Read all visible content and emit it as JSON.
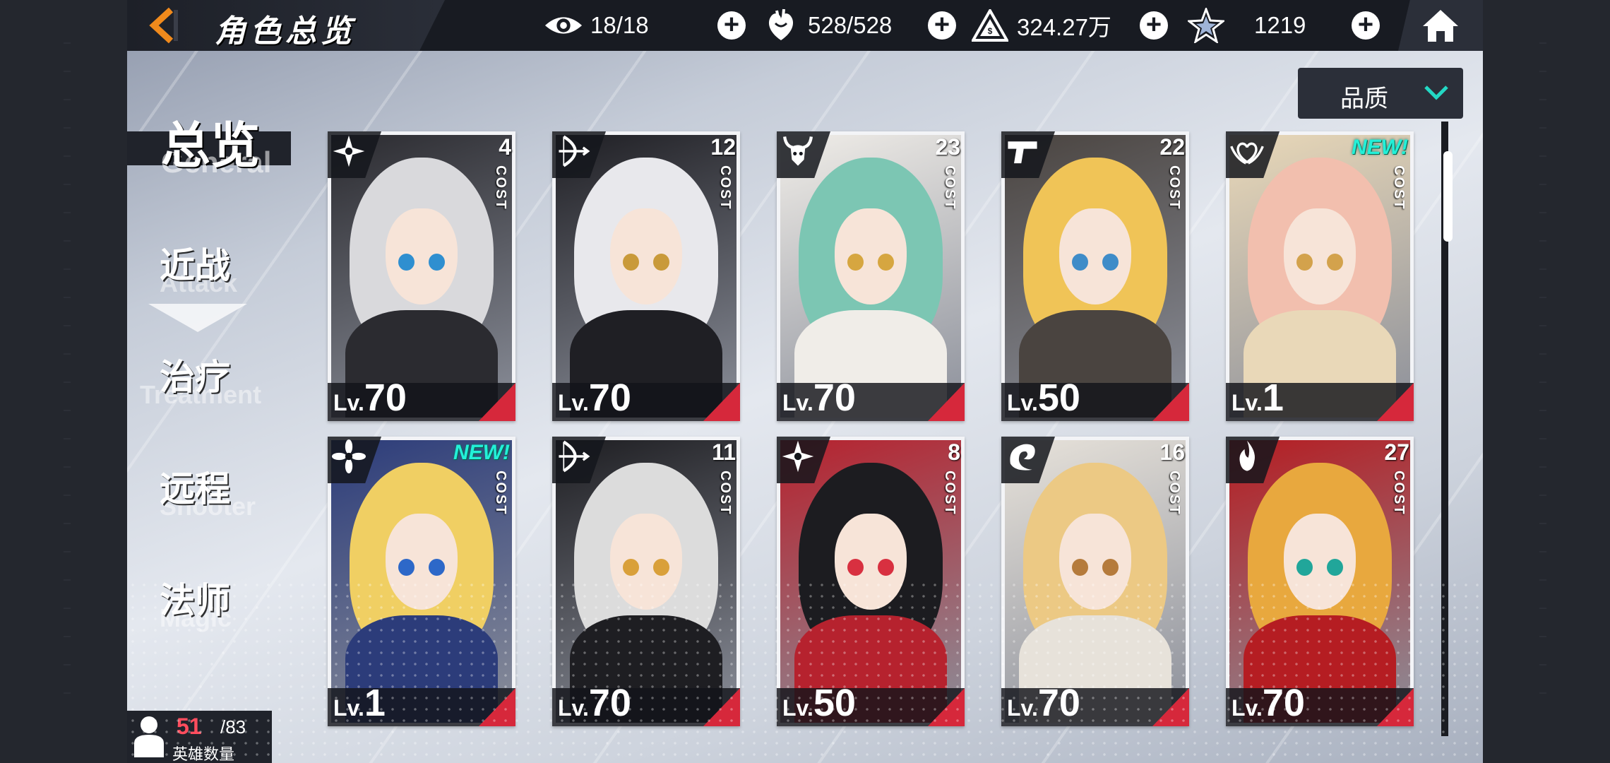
{
  "header": {
    "title": "角色总览"
  },
  "resources": [
    {
      "name": "eye",
      "value": "18/18"
    },
    {
      "name": "heart",
      "value": "528/528"
    },
    {
      "name": "triangle",
      "value": "324.27万"
    },
    {
      "name": "star",
      "value": "1219"
    }
  ],
  "nav": {
    "general": {
      "cn": "总览",
      "en": "General"
    },
    "items": [
      {
        "cn": "近战",
        "en": "Attack"
      },
      {
        "cn": "治疗",
        "en": "Treatment"
      },
      {
        "cn": "远程",
        "en": "Shooter"
      },
      {
        "cn": "法师",
        "en": "Magic"
      }
    ]
  },
  "filter": {
    "label": "品质"
  },
  "hero_count": {
    "current": "51",
    "max": "/83",
    "label": "英雄数量"
  },
  "cards": [
    {
      "role": "shuriken-icon",
      "cost": "4",
      "cost_label": "COST",
      "lv_prefix": "Lv.",
      "level": "70",
      "new": "",
      "hair": "#d9d9dc",
      "eyes": "#2f8fd0",
      "body": "#2b2b30"
    },
    {
      "role": "bow-icon",
      "cost": "12",
      "cost_label": "COST",
      "lv_prefix": "Lv.",
      "level": "70",
      "new": "",
      "hair": "#e8e8ec",
      "eyes": "#c99a3a",
      "body": "#1f1f24"
    },
    {
      "role": "horned-skull-icon",
      "cost": "23",
      "cost_label": "COST",
      "lv_prefix": "Lv.",
      "level": "70",
      "new": "",
      "hair": "#7cc6b3",
      "eyes": "#d6a640",
      "body": "#f0ede8"
    },
    {
      "role": "pistol-icon",
      "cost": "22",
      "cost_label": "COST",
      "lv_prefix": "Lv.",
      "level": "50",
      "new": "",
      "hair": "#f0c457",
      "eyes": "#3f8cc8",
      "body": "#4a4440"
    },
    {
      "role": "heart-wings-icon",
      "cost": "",
      "cost_label": "COST",
      "lv_prefix": "Lv.",
      "level": "1",
      "new": "NEW!",
      "hair": "#f2bfae",
      "eyes": "#d3a24c",
      "body": "#e9d8b8"
    },
    {
      "role": "flower-icon",
      "cost": "",
      "cost_label": "COST",
      "lv_prefix": "Lv.",
      "level": "1",
      "new": "NEW!",
      "hair": "#f0cf63",
      "eyes": "#2d68c8",
      "body": "#2c3c7a"
    },
    {
      "role": "bow-icon",
      "cost": "11",
      "cost_label": "COST",
      "lv_prefix": "Lv.",
      "level": "70",
      "new": "",
      "hair": "#dcdcdc",
      "eyes": "#d9a03a",
      "body": "#1e1e22"
    },
    {
      "role": "shuriken-icon",
      "cost": "8",
      "cost_label": "COST",
      "lv_prefix": "Lv.",
      "level": "50",
      "new": "",
      "hair": "#1c1c20",
      "eyes": "#d83040",
      "body": "#b6222e"
    },
    {
      "role": "dragon-icon",
      "cost": "16",
      "cost_label": "COST",
      "lv_prefix": "Lv.",
      "level": "70",
      "new": "",
      "hair": "#ecc984",
      "eyes": "#b57b3c",
      "body": "#e7e2da"
    },
    {
      "role": "flame-icon",
      "cost": "27",
      "cost_label": "COST",
      "lv_prefix": "Lv.",
      "level": "70",
      "new": "",
      "hair": "#e8a83e",
      "eyes": "#21a69a",
      "body": "#b51d22"
    }
  ],
  "colors": {
    "accent": "#ff4d5e",
    "level_corner": "#d6283b",
    "new_badge": "#23f0d8",
    "back_arrow": "#f08a1c"
  }
}
